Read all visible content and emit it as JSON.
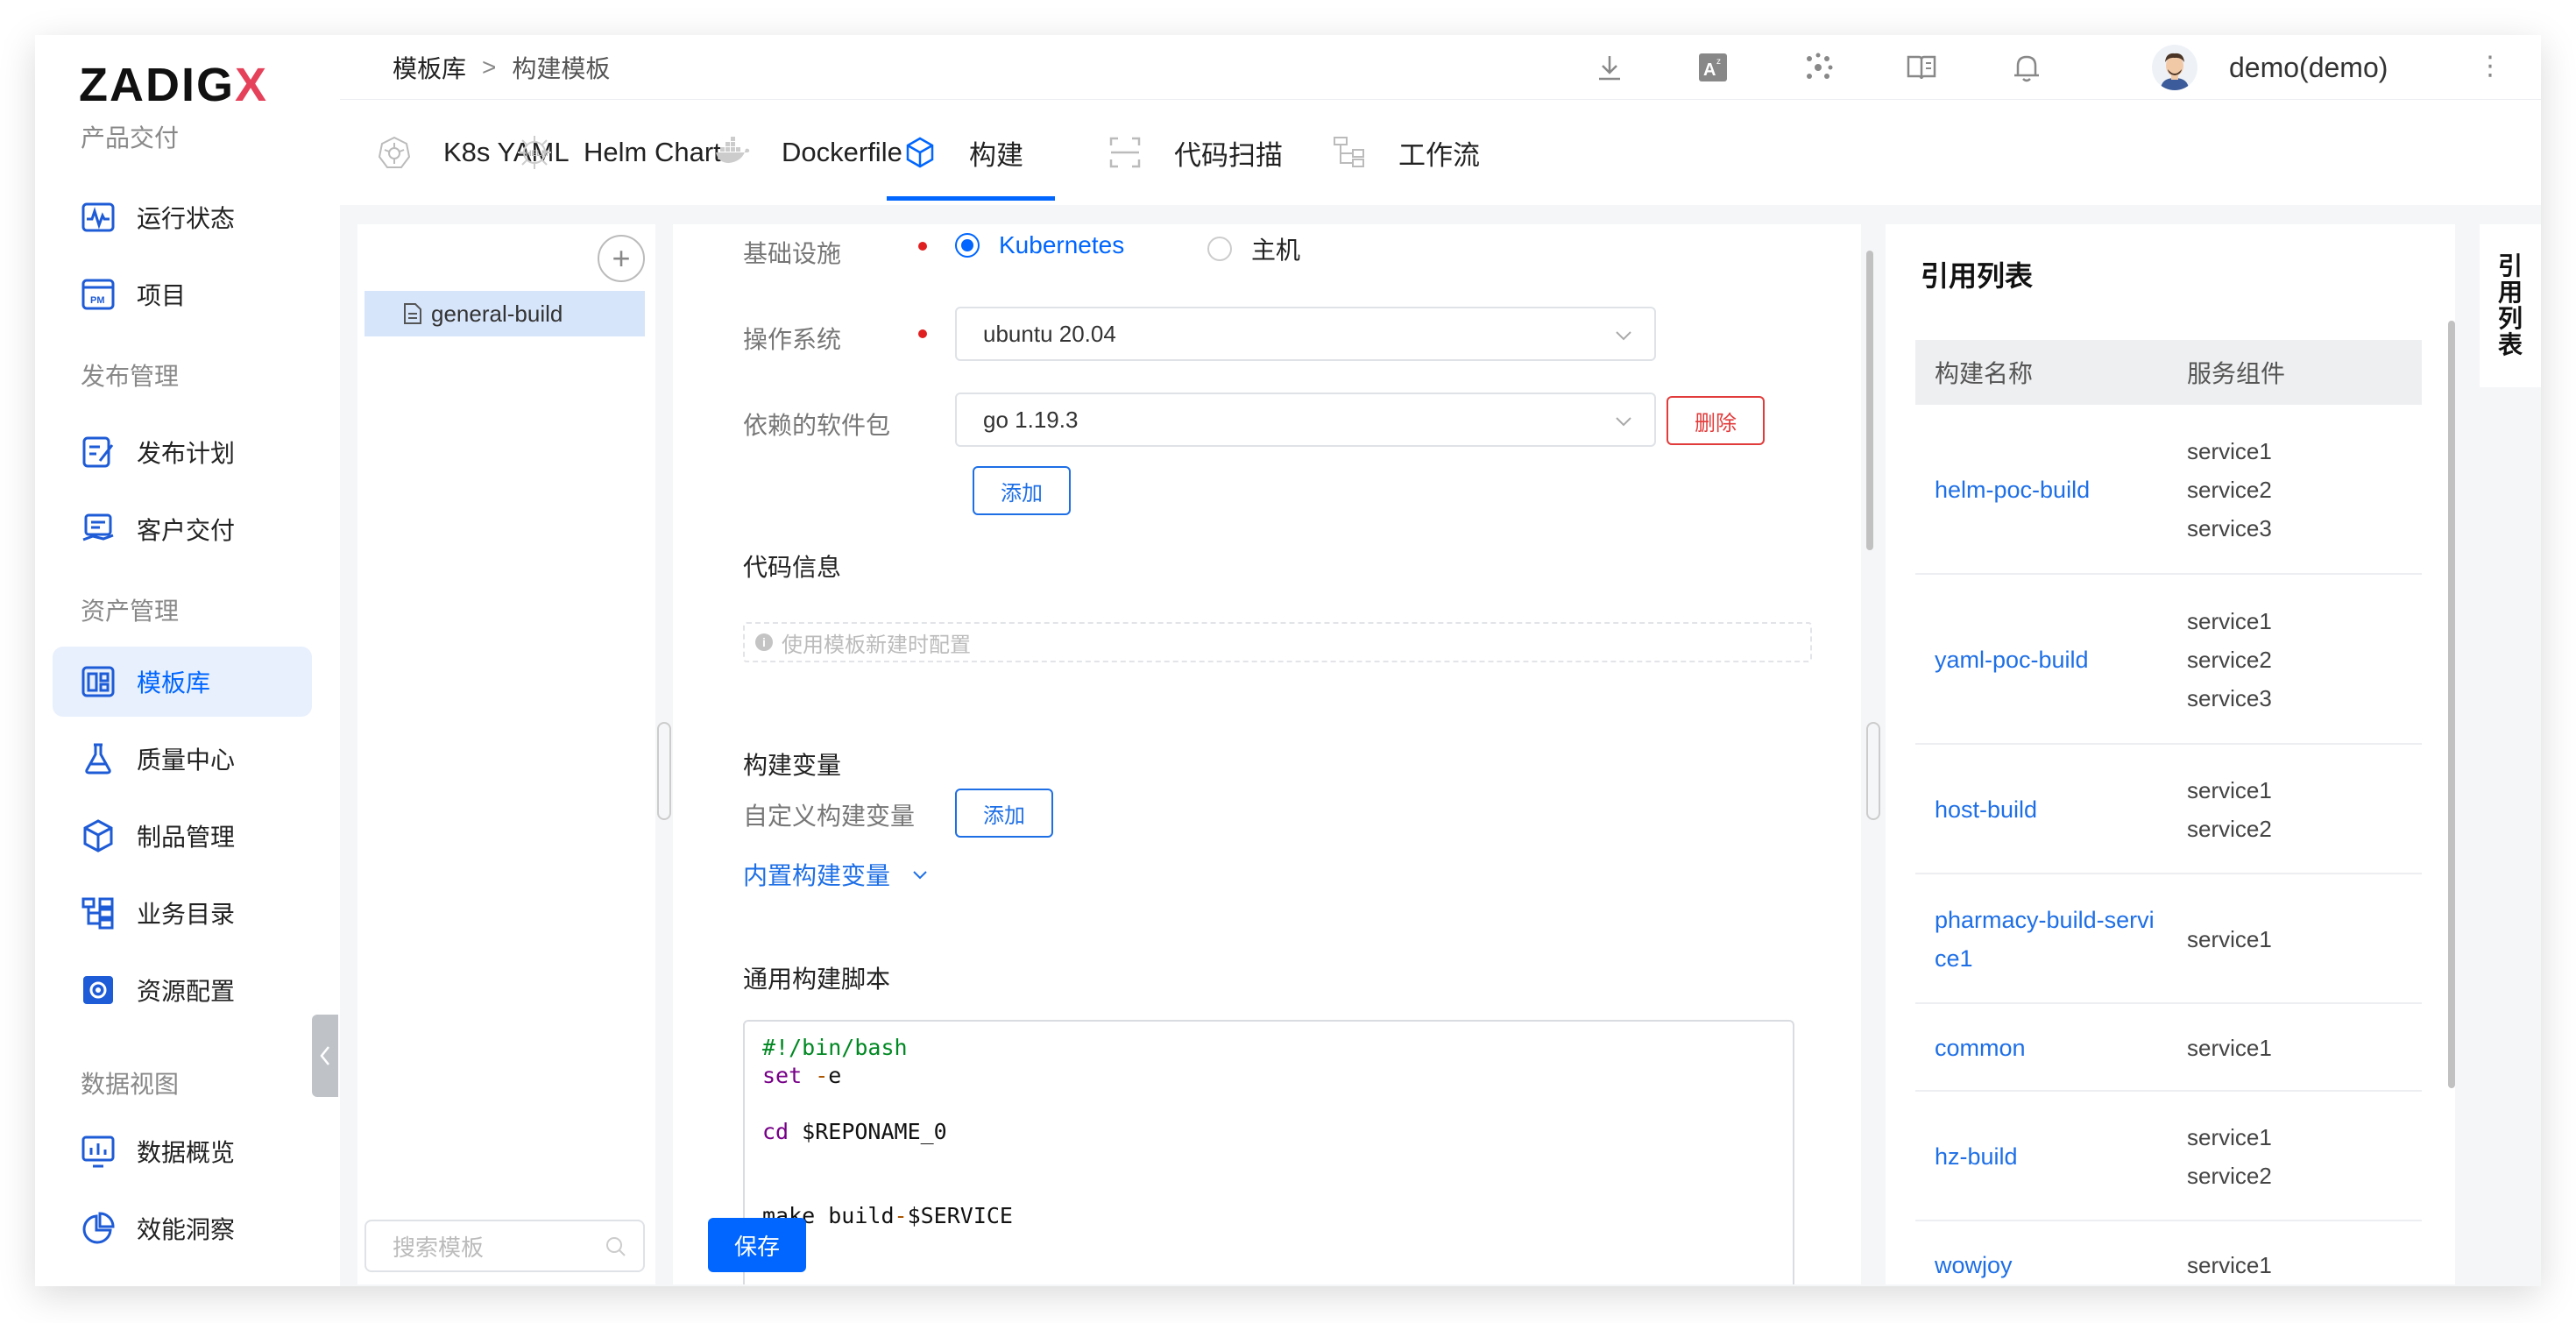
{
  "sidebar": {
    "logo_text": "ZADIG",
    "logo_x": "X",
    "sections": [
      {
        "title": "产品交付",
        "items": [
          {
            "label": "运行状态",
            "icon": "pulse-icon"
          },
          {
            "label": "项目",
            "icon": "project-pm-icon"
          }
        ]
      },
      {
        "title": "发布管理",
        "items": [
          {
            "label": "发布计划",
            "icon": "release-plan-icon"
          },
          {
            "label": "客户交付",
            "icon": "customer-delivery-icon"
          }
        ]
      },
      {
        "title": "资产管理",
        "items": [
          {
            "label": "模板库",
            "icon": "template-library-icon"
          },
          {
            "label": "质量中心",
            "icon": "flask-icon"
          },
          {
            "label": "制品管理",
            "icon": "artifact-box-icon"
          },
          {
            "label": "业务目录",
            "icon": "catalog-tree-icon"
          },
          {
            "label": "资源配置",
            "icon": "resource-gear-icon"
          }
        ]
      },
      {
        "title": "数据视图",
        "items": [
          {
            "label": "数据概览",
            "icon": "data-chart-icon"
          },
          {
            "label": "效能洞察",
            "icon": "pie-insight-icon"
          }
        ]
      }
    ],
    "active_item": "模板库"
  },
  "header": {
    "breadcrumb": [
      "模板库",
      ">",
      "构建模板"
    ],
    "icons": [
      "download-icon",
      "translate-icon",
      "plugin-dots-icon",
      "docs-book-icon",
      "bell-icon"
    ],
    "user": "demo(demo)"
  },
  "tabs": [
    {
      "label": "K8s YAML",
      "icon": "kubernetes-icon"
    },
    {
      "label": "Helm Chart",
      "icon": "helm-icon"
    },
    {
      "label": "Dockerfile",
      "icon": "docker-icon"
    },
    {
      "label": "构建",
      "icon": "build-cube-icon",
      "active": true
    },
    {
      "label": "代码扫描",
      "icon": "scan-icon"
    },
    {
      "label": "工作流",
      "icon": "workflow-icon"
    }
  ],
  "template_list": {
    "items": [
      "general-build"
    ],
    "search_placeholder": "搜索模板"
  },
  "form": {
    "infra_label": "基础设施",
    "infra_options": [
      "Kubernetes",
      "主机"
    ],
    "infra_selected": "Kubernetes",
    "os_label": "操作系统",
    "os_value": "ubuntu 20.04",
    "pkg_label": "依赖的软件包",
    "pkg_value": "go 1.19.3",
    "delete_label": "删除",
    "add_label": "添加",
    "code_info_title": "代码信息",
    "code_info_hint": "使用模板新建时配置",
    "build_vars_title": "构建变量",
    "custom_vars_label": "自定义构建变量",
    "builtin_vars_label": "内置构建变量",
    "script_title": "通用构建脚本",
    "script_lines": [
      "#!/bin/bash",
      "set -e",
      "",
      "cd $REPONAME_0",
      "",
      "",
      "make build-$SERVICE"
    ],
    "save_label": "保存"
  },
  "references": {
    "title": "引用列表",
    "columns": [
      "构建名称",
      "服务组件"
    ],
    "rows": [
      {
        "name": "helm-poc-build",
        "services": [
          "service1",
          "service2",
          "service3"
        ]
      },
      {
        "name": "yaml-poc-build",
        "services": [
          "service1",
          "service2",
          "service3"
        ]
      },
      {
        "name": "host-build",
        "services": [
          "service1",
          "service2"
        ]
      },
      {
        "name": "pharmacy-build-service1",
        "services": [
          "service1"
        ]
      },
      {
        "name": "common",
        "services": [
          "service1"
        ]
      },
      {
        "name": "hz-build",
        "services": [
          "service1",
          "service2"
        ]
      },
      {
        "name": "wowjoy",
        "services": [
          "service1"
        ]
      }
    ],
    "side_tab": "引用列表"
  },
  "colors": {
    "accent": "#0066ff",
    "danger": "#e23b3b",
    "logo_x": "#e5415a"
  }
}
